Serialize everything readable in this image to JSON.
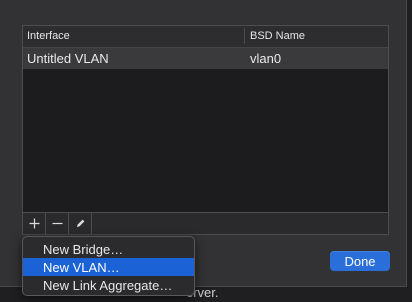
{
  "table": {
    "columns": [
      "Interface",
      "BSD Name"
    ],
    "rows": [
      {
        "interface": "Untitled VLAN",
        "bsd_name": "vlan0"
      }
    ]
  },
  "toolbar": {
    "add_icon": "plus-icon",
    "remove_icon": "minus-icon",
    "edit_icon": "pencil-icon"
  },
  "menu": {
    "items": [
      {
        "label": "New Bridge…"
      },
      {
        "label": "New VLAN…",
        "selected": true
      },
      {
        "label": "New Link Aggregate…"
      }
    ]
  },
  "done_label": "Done",
  "background_text": "erver.",
  "colors": {
    "accent": "#2a6fd9",
    "menu_highlight": "#1b62d6"
  }
}
